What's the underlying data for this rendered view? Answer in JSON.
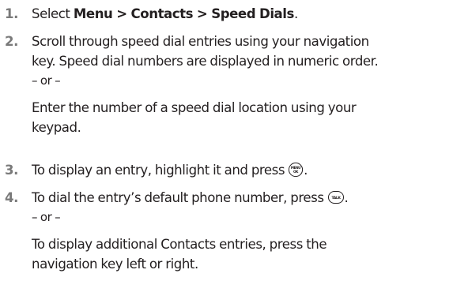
{
  "steps": [
    {
      "number": "1.",
      "prefix": "Select ",
      "bold": "Menu > Contacts > Speed Dials",
      "suffix": "."
    },
    {
      "number": "2.",
      "line1": "Scroll through speed dial entries using your navigation",
      "line2": "key. Speed dial numbers are displayed in numeric order.",
      "or": "– or –",
      "line3": "Enter the number of a speed dial location using your",
      "line4": "keypad."
    },
    {
      "number": "3.",
      "text": "To display an entry, highlight it and press",
      "key_icon": "menu-ok-key-icon",
      "key_label_top": "MENU",
      "key_label_bottom": "OK",
      "suffix": "."
    },
    {
      "number": "4.",
      "text": "To dial the entry’s default phone number, press",
      "key_icon": "talk-key-icon",
      "key_label": "TALK",
      "suffix": ".",
      "or": "– or –",
      "line3": "To display additional Contacts entries, press the",
      "line4": "navigation key left or right."
    }
  ]
}
